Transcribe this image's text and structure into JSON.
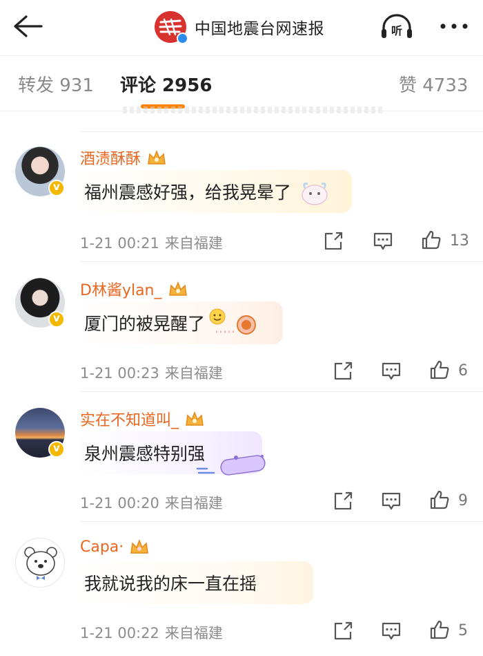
{
  "header": {
    "title": "中国地震台网速报",
    "listen_label": "听"
  },
  "tabs": [
    {
      "label": "转发 931"
    },
    {
      "label": "评论 2956"
    },
    {
      "label": "赞 4733"
    }
  ],
  "comments": [
    {
      "username": "酒渍酥酥",
      "text": "福州震感好强，给我晃晕了",
      "time": "1-21 00:21",
      "location": "来自福建",
      "likes": "13"
    },
    {
      "username": "D林酱ylan_",
      "text": "厦门的被晃醒了",
      "time": "1-21 00:23",
      "location": "来自福建",
      "likes": "6"
    },
    {
      "username": "实在不知道叫_",
      "text": "泉州震感特别强",
      "time": "1-21 00:20",
      "location": "来自福建",
      "likes": "9"
    },
    {
      "username": "Capa·",
      "text": "我就说我的床一直在摇",
      "time": "1-21 00:22",
      "location": "来自福建",
      "likes": "5"
    }
  ],
  "colors": {
    "accent": "#ff8200",
    "username": "#e8661f",
    "meta": "#8c8c8c"
  },
  "icons": [
    "back-arrow-icon",
    "verified-icon",
    "headphones-icon",
    "more-dots-icon",
    "share-icon",
    "comment-icon",
    "thumbs-up-icon",
    "crown-icon"
  ]
}
